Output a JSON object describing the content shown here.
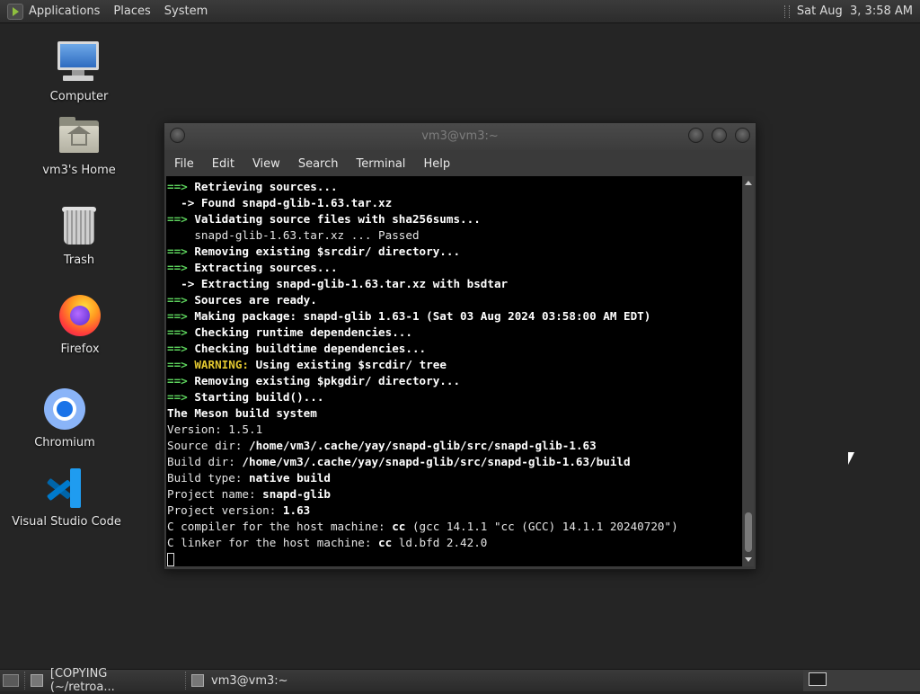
{
  "top_panel": {
    "menus": [
      "Applications",
      "Places",
      "System"
    ],
    "clock": "Sat Aug  3, 3:58 AM"
  },
  "desktop_icons": [
    {
      "label": "Computer",
      "icon": "computer-icon"
    },
    {
      "label": "vm3's Home",
      "icon": "home-folder-icon"
    },
    {
      "label": "Trash",
      "icon": "trash-icon"
    },
    {
      "label": "Firefox",
      "icon": "firefox-icon"
    },
    {
      "label": "Chromium",
      "icon": "chromium-icon"
    },
    {
      "label": "Visual Studio Code",
      "icon": "vscode-icon"
    }
  ],
  "terminal": {
    "title": "vm3@vm3:~",
    "menu": [
      "File",
      "Edit",
      "View",
      "Search",
      "Terminal",
      "Help"
    ],
    "lines": [
      {
        "arrow": "==> ",
        "text": "Retrieving sources...",
        "style": "bold"
      },
      {
        "arrow": "  -> ",
        "text": "Found snapd-glib-1.63.tar.xz",
        "style": "bold"
      },
      {
        "arrow": "==> ",
        "text": "Validating source files with sha256sums...",
        "style": "bold"
      },
      {
        "arrow": "",
        "text": "    snapd-glib-1.63.tar.xz ... Passed",
        "style": "plain"
      },
      {
        "arrow": "==> ",
        "text": "Removing existing $srcdir/ directory...",
        "style": "bold"
      },
      {
        "arrow": "==> ",
        "text": "Extracting sources...",
        "style": "bold"
      },
      {
        "arrow": "  -> ",
        "text": "Extracting snapd-glib-1.63.tar.xz with bsdtar",
        "style": "bold"
      },
      {
        "arrow": "==> ",
        "text": "Sources are ready.",
        "style": "bold"
      },
      {
        "arrow": "==> ",
        "text": "Making package: snapd-glib 1.63-1 (Sat 03 Aug 2024 03:58:00 AM EDT)",
        "style": "bold"
      },
      {
        "arrow": "==> ",
        "text": "Checking runtime dependencies...",
        "style": "bold"
      },
      {
        "arrow": "==> ",
        "text": "Checking buildtime dependencies...",
        "style": "bold"
      },
      {
        "arrow": "==> ",
        "warn": "WARNING:",
        "text": " Using existing $srcdir/ tree",
        "style": "bold"
      },
      {
        "arrow": "==> ",
        "text": "Removing existing $pkgdir/ directory...",
        "style": "bold"
      },
      {
        "arrow": "==> ",
        "text": "Starting build()...",
        "style": "bold"
      },
      {
        "arrow": "",
        "text": "The Meson build system",
        "style": "bold"
      },
      {
        "arrow": "",
        "label": "Version: ",
        "text": "1.5.1",
        "style": "plain"
      },
      {
        "arrow": "",
        "label": "Source dir: ",
        "text": "/home/vm3/.cache/yay/snapd-glib/src/snapd-glib-1.63",
        "style": "bold"
      },
      {
        "arrow": "",
        "label": "Build dir: ",
        "text": "/home/vm3/.cache/yay/snapd-glib/src/snapd-glib-1.63/build",
        "style": "bold"
      },
      {
        "arrow": "",
        "label": "Build type: ",
        "text": "native build",
        "style": "bold"
      },
      {
        "arrow": "",
        "label": "Project name: ",
        "text": "snapd-glib",
        "style": "bold"
      },
      {
        "arrow": "",
        "label": "Project version: ",
        "text": "1.63",
        "style": "bold"
      },
      {
        "arrow": "",
        "label": "C compiler for the host machine: ",
        "text": "cc",
        "tail": " (gcc 14.1.1 \"cc (GCC) 14.1.1 20240720\")",
        "style": "bold"
      },
      {
        "arrow": "",
        "label": "C linker for the host machine: ",
        "text": "cc",
        "tail": " ld.bfd 2.42.0",
        "style": "bold"
      }
    ]
  },
  "taskbar": {
    "tasks": [
      {
        "label": "[COPYING (~/retroa...",
        "icon": "text-editor-icon",
        "active": false
      },
      {
        "label": "vm3@vm3:~",
        "icon": "terminal-icon",
        "active": false
      }
    ]
  },
  "colors": {
    "desktop_bg": "#252525",
    "arrow_green": "#5dd35d",
    "warning_yellow": "#e3c830",
    "terminal_bg": "#000000"
  }
}
